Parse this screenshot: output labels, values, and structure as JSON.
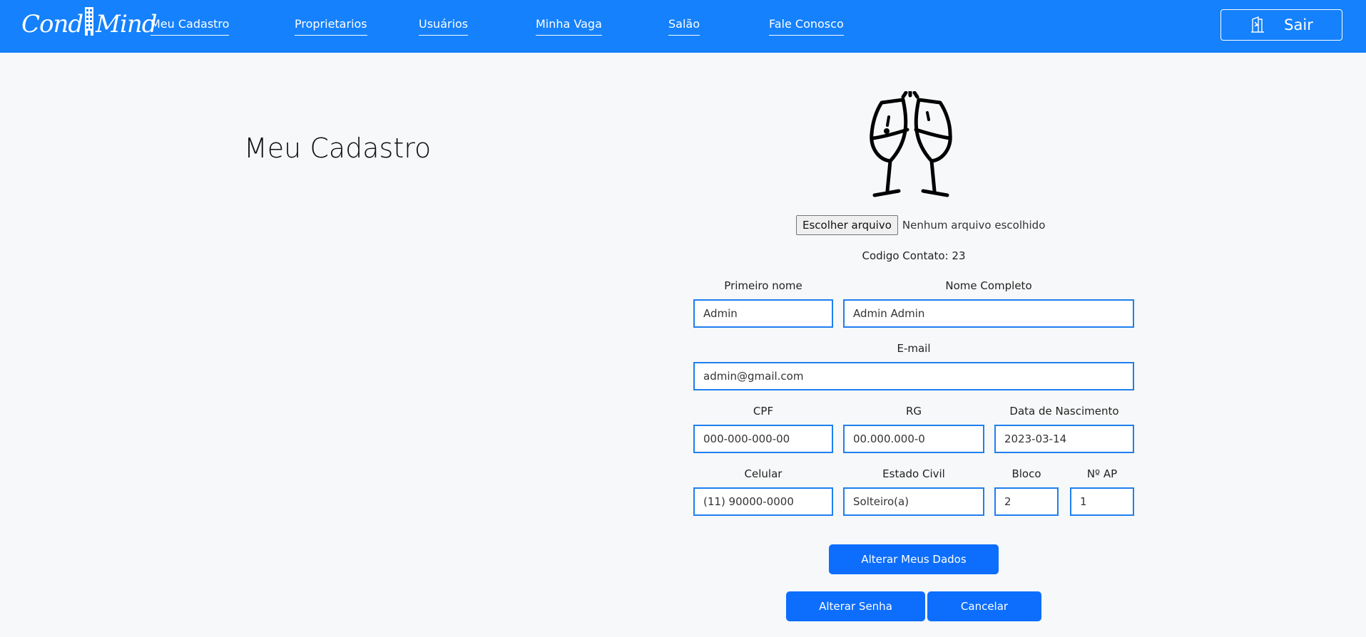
{
  "header": {
    "logo_text_left": "Cond",
    "logo_text_right": "Mind",
    "nav": [
      {
        "label": "Meu Cadastro"
      },
      {
        "label": "Proprietarios"
      },
      {
        "label": "Usuários"
      },
      {
        "label": "Minha Vaga"
      },
      {
        "label": "Salão"
      },
      {
        "label": "Fale Conosco"
      }
    ],
    "logout_label": "Sair",
    "logout_icon": "exit-door-icon"
  },
  "page": {
    "title": "Meu Cadastro",
    "avatar_icon": "toast-glasses-icon"
  },
  "file": {
    "button_label": "Escolher arquivo",
    "status": "Nenhum arquivo escolhido"
  },
  "codigo_contato": "Codigo Contato: 23",
  "form": {
    "primeiro_nome": {
      "label": "Primeiro nome",
      "value": "Admin"
    },
    "nome_completo": {
      "label": "Nome Completo",
      "value": "Admin Admin"
    },
    "email": {
      "label": "E-mail",
      "value": "admin@gmail.com"
    },
    "cpf": {
      "label": "CPF",
      "value": "000-000-000-00"
    },
    "rg": {
      "label": "RG",
      "value": "00.000.000-0"
    },
    "nascimento": {
      "label": "Data de Nascimento",
      "value": "2023-03-14"
    },
    "celular": {
      "label": "Celular",
      "value": "(11) 90000-0000"
    },
    "estado_civil": {
      "label": "Estado Civil",
      "value": "Solteiro(a)"
    },
    "bloco": {
      "label": "Bloco",
      "value": "2"
    },
    "apto": {
      "label": "Nº AP",
      "value": "1"
    }
  },
  "actions": {
    "alterar_dados": "Alterar Meus Dados",
    "alterar_senha": "Alterar Senha",
    "cancelar": "Cancelar"
  },
  "colors": {
    "header_bg": "#1581fc",
    "input_border": "#1e7ff0",
    "button_bg": "#0d6efd",
    "page_bg": "#f7f8f9"
  }
}
